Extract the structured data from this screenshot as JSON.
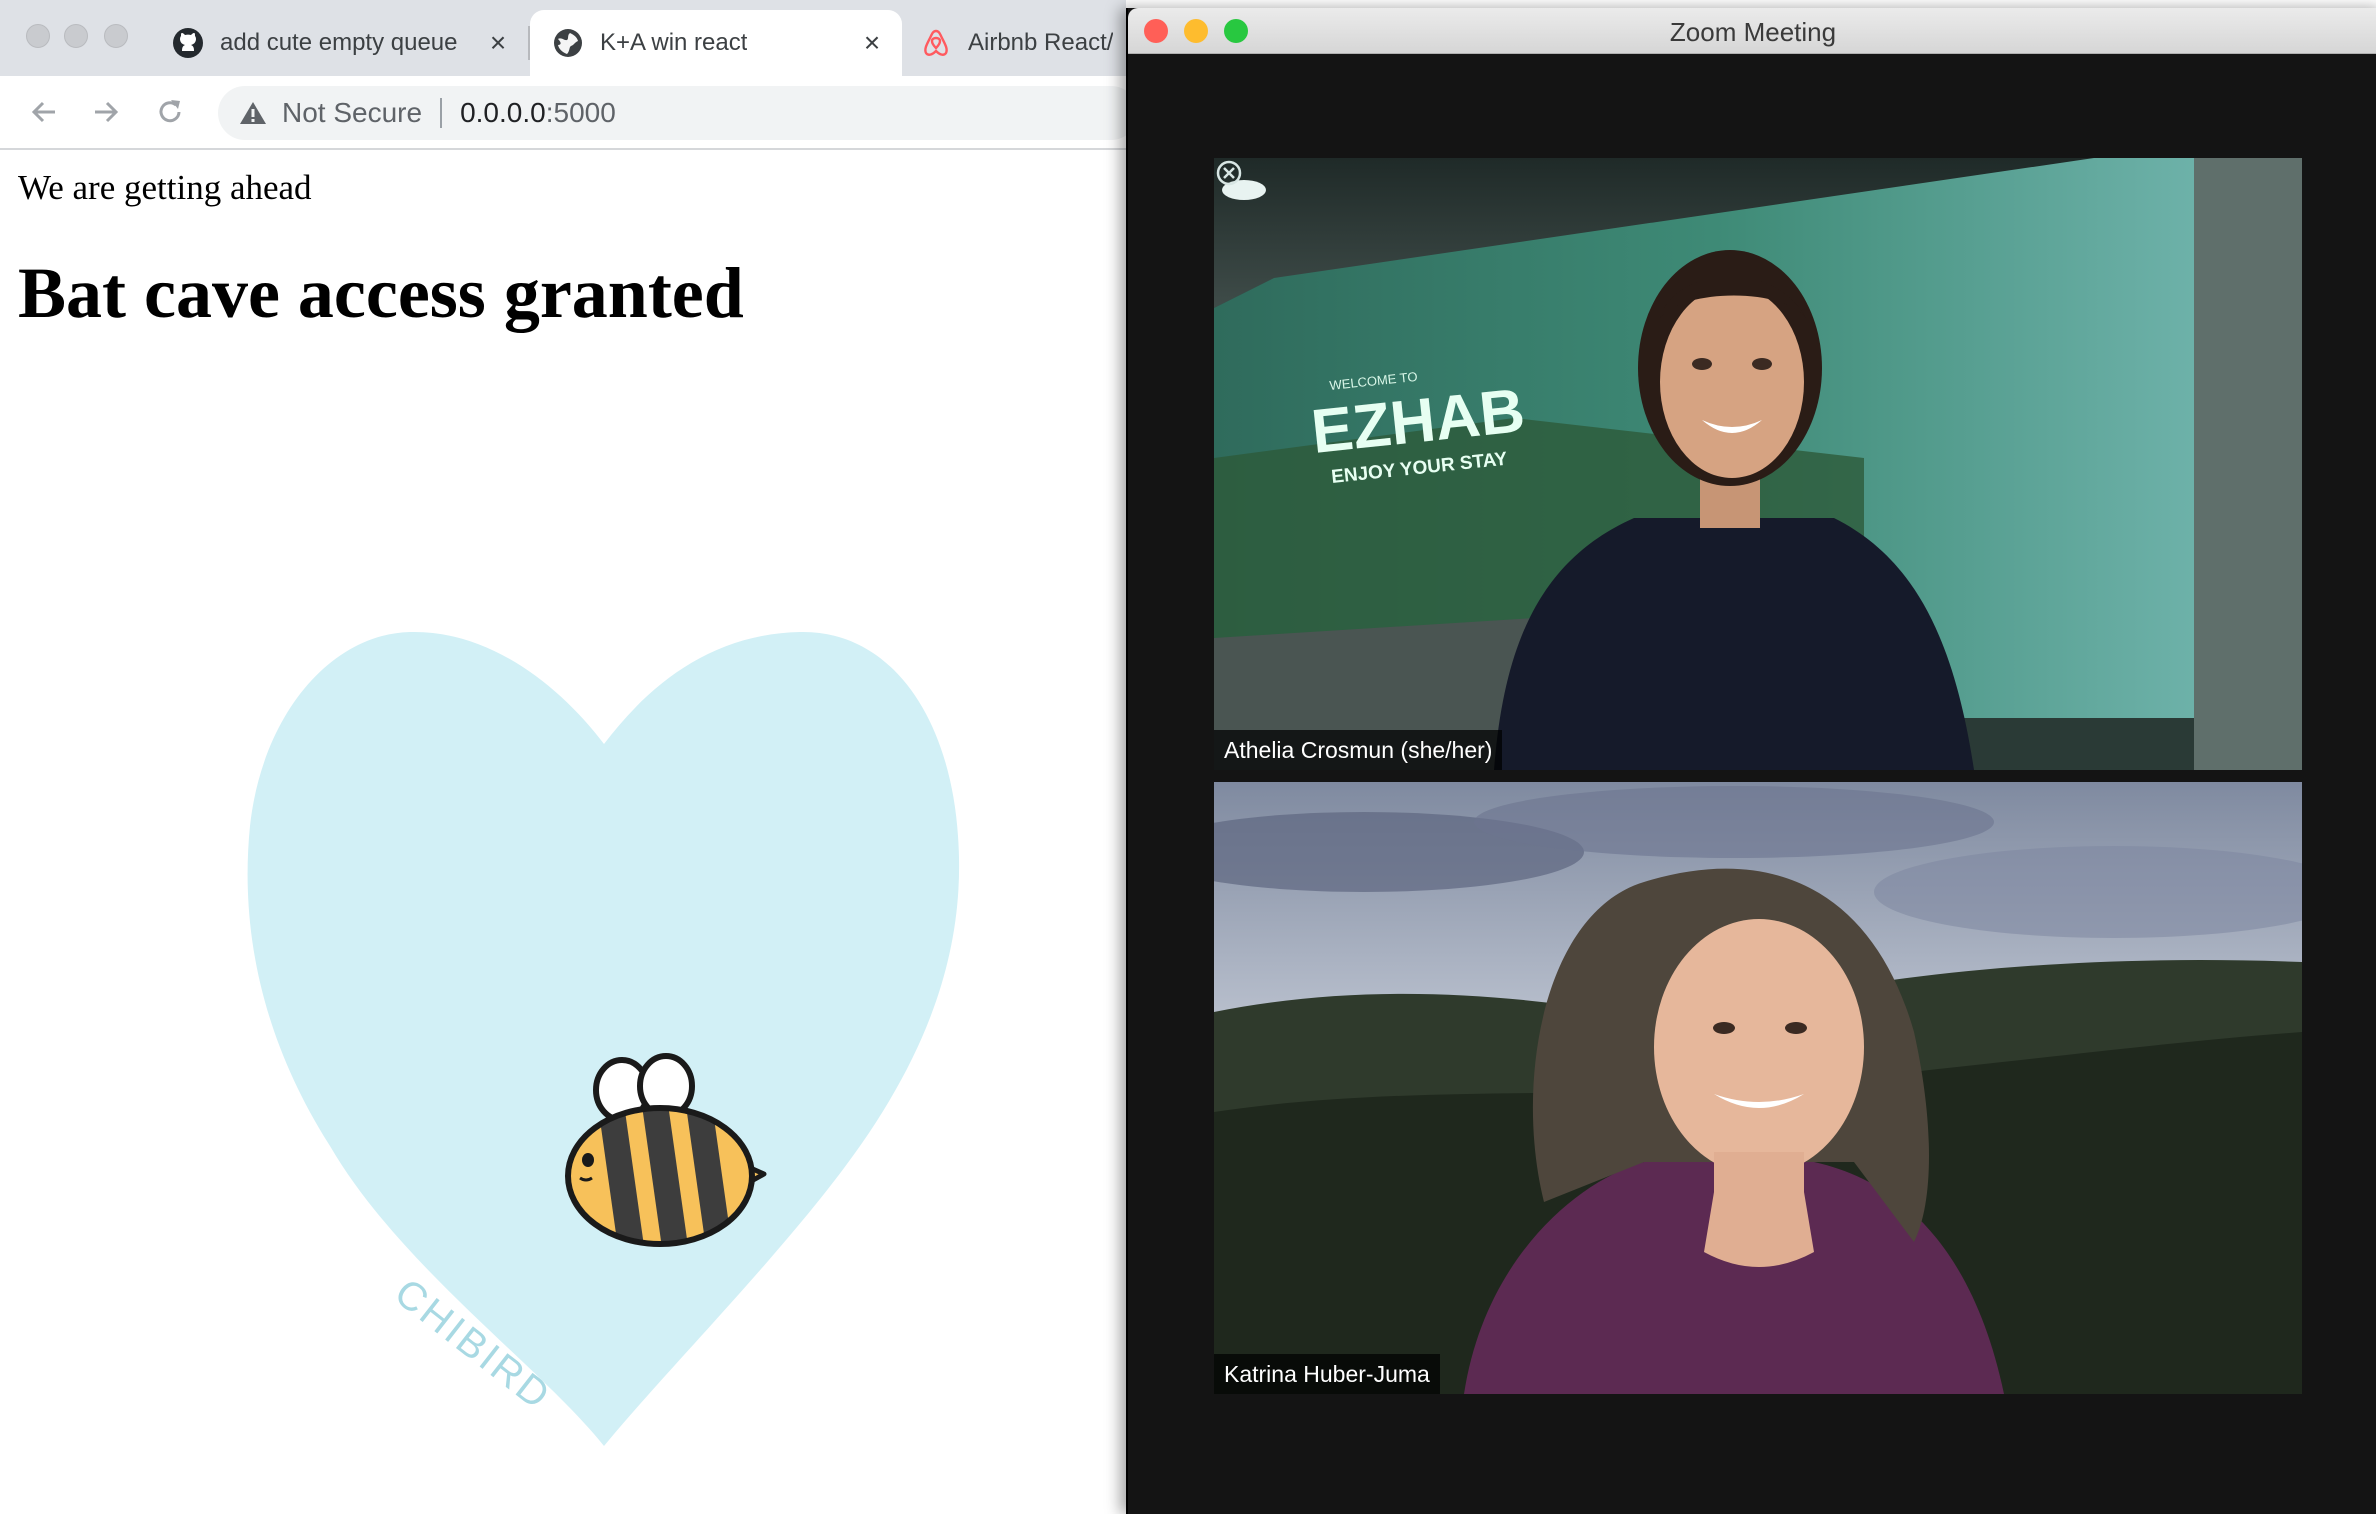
{
  "browser": {
    "tabs": [
      {
        "title": "add cute empty queue",
        "icon": "github-icon",
        "active": false
      },
      {
        "title": "K+A win react",
        "icon": "globe-icon",
        "active": true
      },
      {
        "title": "Airbnb React/",
        "icon": "airbnb-icon",
        "active": false
      }
    ],
    "address": {
      "security_label": "Not Secure",
      "host": "0.0.0.0",
      "port": ":5000"
    }
  },
  "page": {
    "paragraph": "We are getting ahead",
    "heading": "Bat cave access granted",
    "image": {
      "watermark": "CHIBIRD",
      "heart_color": "#d2f0f6",
      "subject": "bee"
    }
  },
  "zoom": {
    "window_title": "Zoom Meeting",
    "participants": [
      {
        "name": "Athelia Crosmun (she/her)",
        "background": "EZHAB virtual background"
      },
      {
        "name": "Katrina Huber-Juma",
        "background": "forest landscape"
      }
    ],
    "virtual_bg_text": {
      "welcome": "WELCOME TO",
      "logo": "EZHAB",
      "tagline": "ENJOY YOUR STAY"
    }
  },
  "colors": {
    "close": "#ff5f57",
    "minimize": "#febc2e",
    "zoom": "#28c840",
    "bee_yellow": "#f7c15a",
    "bee_stripe": "#3d3d3d"
  }
}
